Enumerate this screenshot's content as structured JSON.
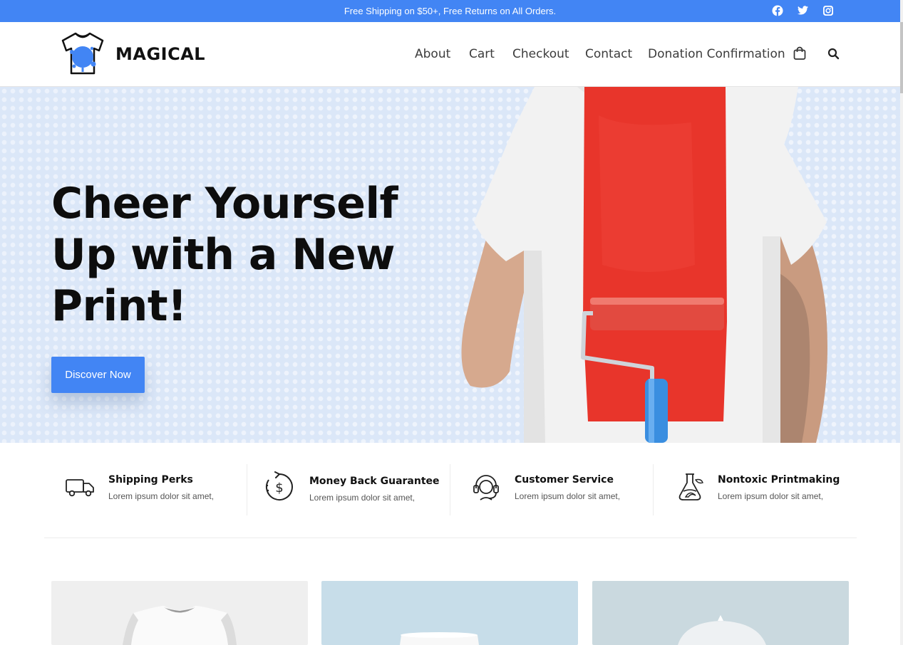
{
  "topbar": {
    "announcement": "Free Shipping on $50+, Free Returns on All Orders.",
    "social_icons": [
      "facebook-icon",
      "twitter-icon",
      "instagram-icon"
    ],
    "background_color": "#4285f4"
  },
  "header": {
    "logo_text": "MAGICAL",
    "nav": [
      {
        "label": "About"
      },
      {
        "label": "Cart"
      },
      {
        "label": "Checkout"
      },
      {
        "label": "Contact"
      },
      {
        "label": "Donation Confirmation"
      }
    ],
    "icons": [
      "cart-icon",
      "search-icon"
    ]
  },
  "hero": {
    "title": "Cheer Yourself Up with a New Print!",
    "button_label": "Discover Now",
    "accent_color": "#4285f4",
    "paint_color": "#e8352b"
  },
  "features": [
    {
      "icon": "truck-icon",
      "title": "Shipping Perks",
      "description": "Lorem ipsum dolor sit amet,"
    },
    {
      "icon": "money-back-icon",
      "title": "Money Back Guarantee",
      "description": "Lorem ipsum dolor sit amet,"
    },
    {
      "icon": "headset-icon",
      "title": "Customer Service",
      "description": "Lorem ipsum dolor sit amet,"
    },
    {
      "icon": "flask-icon",
      "title": "Nontoxic Printmaking",
      "description": "Lorem ipsum dolor sit amet,"
    }
  ],
  "products": [
    {
      "image": "white-tshirt",
      "background": "#efefef"
    },
    {
      "image": "white-mug",
      "background": "#c7dde9"
    },
    {
      "image": "white-cap",
      "background": "#cad9df"
    }
  ]
}
